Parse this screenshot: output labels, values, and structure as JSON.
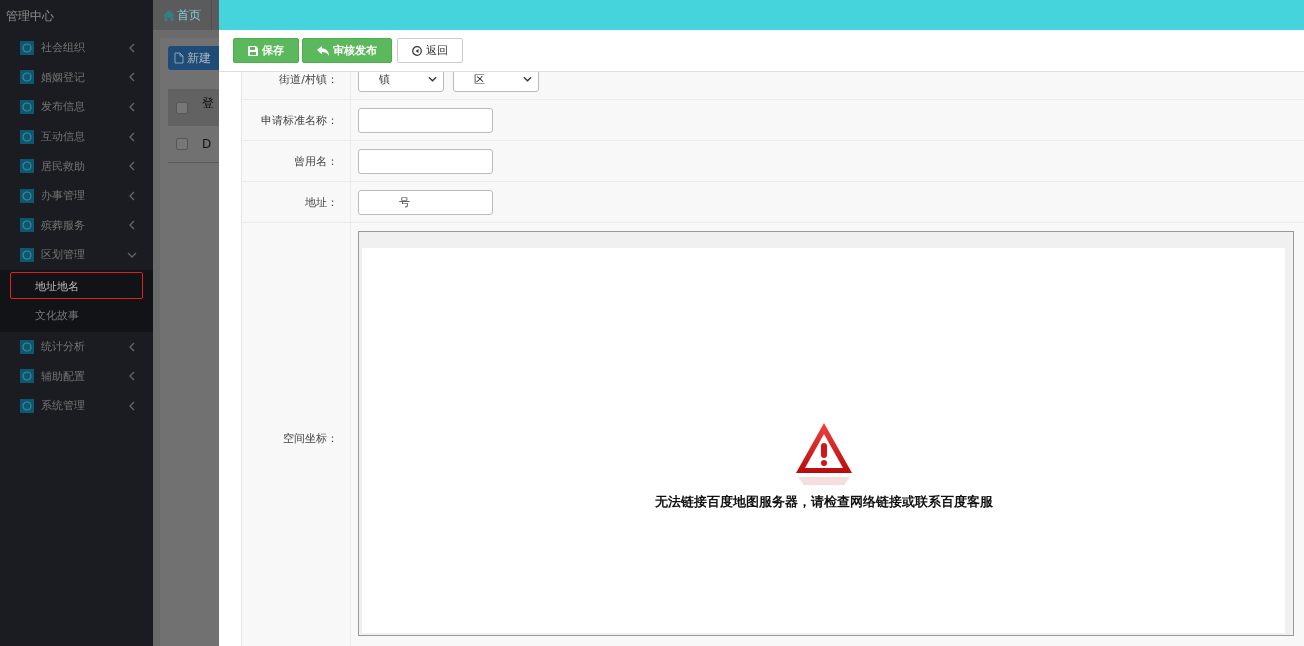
{
  "sidebar": {
    "title": "管理中心",
    "items": [
      {
        "label": "社会组织",
        "expanded": false
      },
      {
        "label": "婚姻登记",
        "expanded": false
      },
      {
        "label": "发布信息",
        "expanded": false
      },
      {
        "label": "互动信息",
        "expanded": false
      },
      {
        "label": "居民救助",
        "expanded": false
      },
      {
        "label": "办事管理",
        "expanded": false
      },
      {
        "label": "殡葬服务",
        "expanded": false
      },
      {
        "label": "区划管理",
        "expanded": true,
        "children": [
          {
            "label": "地址地名",
            "selected": true
          },
          {
            "label": "文化故事",
            "selected": false
          }
        ]
      },
      {
        "label": "统计分析",
        "expanded": false
      },
      {
        "label": "辅助配置",
        "expanded": false
      },
      {
        "label": "系统管理",
        "expanded": false
      }
    ]
  },
  "background_page": {
    "tab": "首页",
    "new_button": "新建",
    "table_header": "登",
    "header_checked": false,
    "table_row": "D",
    "row_checked": false
  },
  "modal": {
    "toolbar": [
      {
        "label": "保存",
        "kind": "save"
      },
      {
        "label": "审核发布",
        "kind": "publish"
      },
      {
        "label": "返回",
        "kind": "back"
      }
    ],
    "rows": [
      {
        "label": "街道/村镇：",
        "kind": "selects",
        "selects": [
          {
            "value": "镇"
          },
          {
            "value": "区"
          }
        ]
      },
      {
        "label": "申请标准名称：",
        "kind": "input"
      },
      {
        "label": "曾用名：",
        "kind": "input"
      },
      {
        "label": "地址：",
        "kind": "input",
        "value": "号"
      },
      {
        "label": "空间坐标：",
        "kind": "map",
        "message": "无法链接百度地图服务器，请检查网络链接或联系百度客服"
      }
    ]
  }
}
